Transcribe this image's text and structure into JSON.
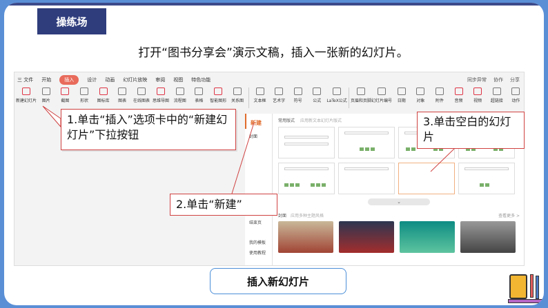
{
  "slide": {
    "badge": "操练场",
    "instruction": "打开“图书分享会”演示文稿，插入一张新的幻灯片。",
    "caption": "插入新幻灯片"
  },
  "app": {
    "menu": {
      "file": "三 文件",
      "tabs": [
        "开始",
        "插入",
        "设计",
        "动画",
        "幻灯片放映",
        "审阅",
        "视图",
        "特色功能"
      ],
      "active_tab": "插入",
      "right": [
        "同步异常",
        "协作",
        "分享"
      ]
    },
    "ribbon": [
      "新建幻灯片",
      "图片",
      "截图",
      "形状",
      "图标库",
      "图表",
      "在线图表",
      "思维导图",
      "流程图",
      "表格",
      "智能图形",
      "关系图",
      "文本框",
      "艺术字",
      "符号",
      "公式",
      "LaTeX公式",
      "页眉和页脚",
      "幻灯片编号",
      "日期",
      "对象",
      "附件",
      "音频",
      "视频",
      "超链接",
      "动作"
    ],
    "left_panel": {
      "new_label": "新建",
      "items": [
        "封面",
        "结束页",
        "我的模板",
        "使用教程"
      ]
    },
    "content": {
      "section_title": "常用版式",
      "section_sub": "应用新文本幻灯片版式",
      "pager": "⌄",
      "cover_title": "封面",
      "cover_sub": "应用多种主题风格",
      "cover_more": "查看更多 >"
    }
  },
  "callouts": {
    "one": "1.单击“插入”选项卡中的“新建幻灯片”下拉按钮",
    "two": "2.单击“新建”",
    "three": "3.单击空白的幻灯片"
  }
}
